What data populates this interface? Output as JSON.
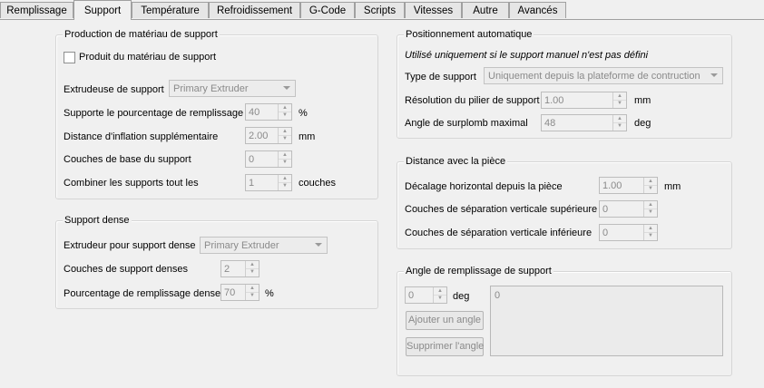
{
  "tabs": [
    {
      "label": "Remplissage",
      "active": false
    },
    {
      "label": "Support",
      "active": true
    },
    {
      "label": "Température",
      "active": false
    },
    {
      "label": "Refroidissement",
      "active": false
    },
    {
      "label": "G-Code",
      "active": false
    },
    {
      "label": "Scripts",
      "active": false
    },
    {
      "label": "Vitesses",
      "active": false
    },
    {
      "label": "Autre",
      "active": false
    },
    {
      "label": "Avancés",
      "active": false
    }
  ],
  "production": {
    "title": "Production de matériau de support",
    "checkbox_label": "Produit du matériau de support",
    "extruder_label": "Extrudeuse de support",
    "extruder_value": "Primary Extruder",
    "infill_label": "Supporte le pourcentage de remplissage",
    "infill_value": "40",
    "infill_unit": "%",
    "inflation_label": "Distance d'inflation supplémentaire",
    "inflation_value": "2.00",
    "inflation_unit": "mm",
    "base_layers_label": "Couches de base du support",
    "base_layers_value": "0",
    "combine_label": "Combiner les supports tout les",
    "combine_value": "1",
    "combine_unit": "couches"
  },
  "dense": {
    "title": "Support dense",
    "extruder_label": "Extrudeur pour support dense",
    "extruder_value": "Primary Extruder",
    "layers_label": "Couches de support denses",
    "layers_value": "2",
    "infill_label": "Pourcentage de remplissage dense",
    "infill_value": "70",
    "infill_unit": "%"
  },
  "auto": {
    "title": "Positionnement automatique",
    "note": "Utilisé uniquement si le support manuel n'est pas défini",
    "type_label": "Type de support",
    "type_value": "Uniquement depuis la plateforme de contruction",
    "pillar_label": "Résolution du pilier de support",
    "pillar_value": "1.00",
    "pillar_unit": "mm",
    "overhang_label": "Angle de surplomb maximal",
    "overhang_value": "48",
    "overhang_unit": "deg"
  },
  "distance": {
    "title": "Distance avec la pièce",
    "horizontal_label": "Décalage horizontal depuis la pièce",
    "horizontal_value": "1.00",
    "horizontal_unit": "mm",
    "top_label": "Couches de séparation verticale supérieure",
    "top_value": "0",
    "bottom_label": "Couches de séparation verticale inférieure",
    "bottom_value": "0"
  },
  "angle": {
    "title": "Angle de remplissage de support",
    "value": "0",
    "unit": "deg",
    "add_label": "Ajouter un angle",
    "remove_label": "Supprimer l'angle",
    "list_items": [
      "0"
    ]
  }
}
